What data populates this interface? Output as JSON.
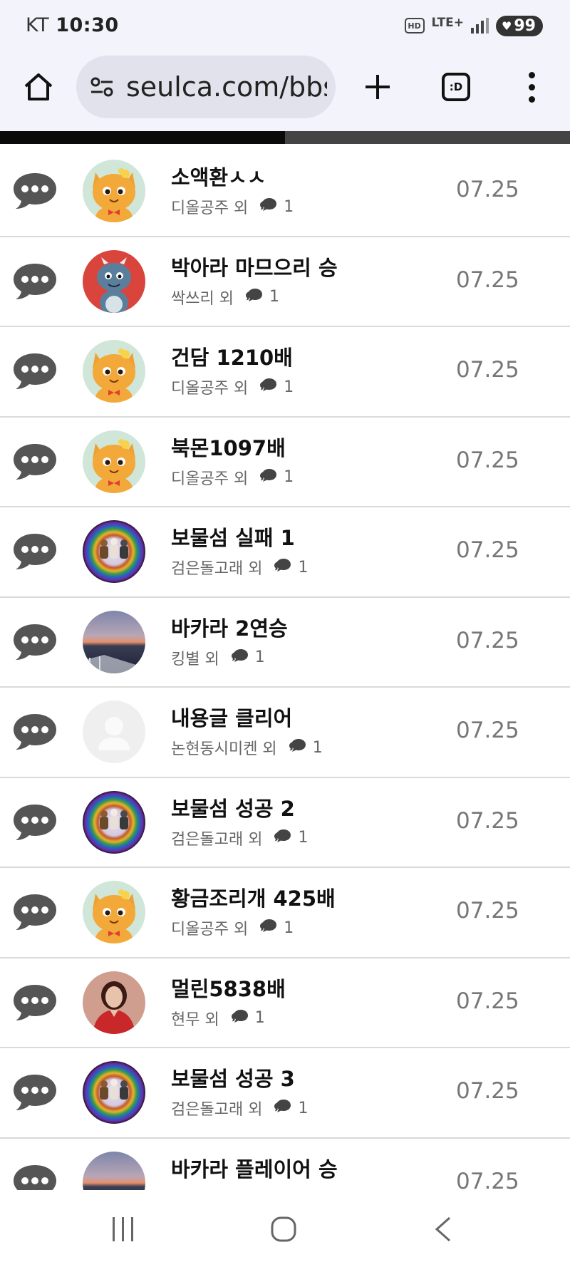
{
  "status_bar": {
    "carrier": "KT",
    "time": "10:30",
    "hd": "HD",
    "network": "LTE+",
    "battery": "99"
  },
  "browser": {
    "url": "seulca.com/bbs",
    "tab_count": ":D",
    "load_progress": 0.5
  },
  "posts": [
    {
      "title": "소액환ㅅㅅ",
      "author": "디올공주 외",
      "comments": "1",
      "date": "07.25",
      "avatar": "cat-avatar"
    },
    {
      "title": "박아라 마므으리 승",
      "author": "싹쓰리 외",
      "comments": "1",
      "date": "07.25",
      "avatar": "dragon-avatar"
    },
    {
      "title": "건담 1210배",
      "author": "디올공주 외",
      "comments": "1",
      "date": "07.25",
      "avatar": "cat-avatar"
    },
    {
      "title": "북몬1097배",
      "author": "디올공주 외",
      "comments": "1",
      "date": "07.25",
      "avatar": "cat-avatar"
    },
    {
      "title": "보물섬 실패 1",
      "author": "검은돌고래 외",
      "comments": "1",
      "date": "07.25",
      "avatar": "rainbow-avatar"
    },
    {
      "title": "바카라 2연승",
      "author": "킹별 외",
      "comments": "1",
      "date": "07.25",
      "avatar": "sea-avatar"
    },
    {
      "title": "내용글 클리어",
      "author": "논현동시미켄 외",
      "comments": "1",
      "date": "07.25",
      "avatar": "default-avatar"
    },
    {
      "title": "보물섬 성공 2",
      "author": "검은돌고래 외",
      "comments": "1",
      "date": "07.25",
      "avatar": "rainbow-avatar"
    },
    {
      "title": "황금조리개 425배",
      "author": "디올공주 외",
      "comments": "1",
      "date": "07.25",
      "avatar": "cat-avatar"
    },
    {
      "title": "멀린5838배",
      "author": "현무 외",
      "comments": "1",
      "date": "07.25",
      "avatar": "woman-avatar"
    },
    {
      "title": "보물섬 성공 3",
      "author": "검은돌고래 외",
      "comments": "1",
      "date": "07.25",
      "avatar": "rainbow-avatar"
    },
    {
      "title": "바카라 플레이어 승",
      "author": "",
      "comments": "",
      "date": "07.25",
      "avatar": "sea-avatar"
    }
  ]
}
